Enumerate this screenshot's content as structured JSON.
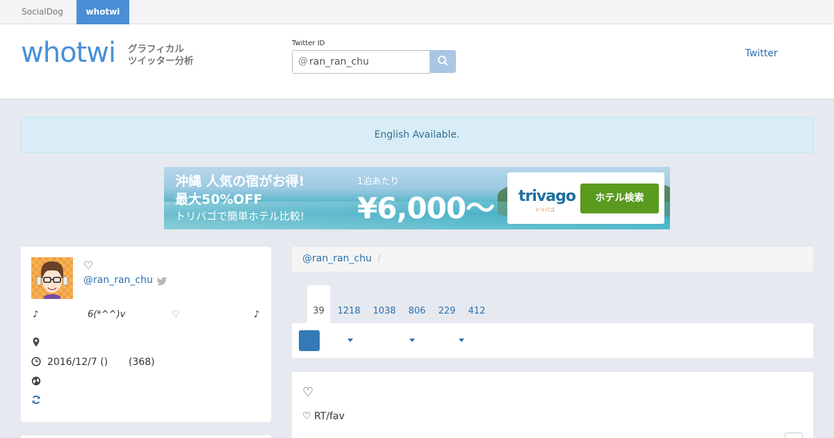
{
  "topbar": {
    "tabs": [
      {
        "label": "SocialDog",
        "active": false
      },
      {
        "label": "whotwi",
        "active": true
      }
    ]
  },
  "header": {
    "logo": "whotwi",
    "tagline_1": "グラフィカル",
    "tagline_2": "ツイッター分析",
    "search_label": "Twitter ID",
    "search_prefix": "@",
    "search_value": "ran_ran_chu",
    "twitter_link": "Twitter"
  },
  "alert": {
    "text": "English Available."
  },
  "banner": {
    "line1": "沖縄 人気の宿がお得!",
    "line2": "最大50%OFF",
    "line3": "トリバゴで簡単ホテル比較!",
    "per_night": "1泊あたり",
    "price": "¥6,000〜",
    "brand": "trivago",
    "brand_sub": "トリバゴ",
    "button": "ホテル検索"
  },
  "profile": {
    "heart": "♡",
    "handle": "@ran_ran_chu",
    "bio": [
      "♪",
      "6(*^^)v",
      "♡",
      "♪"
    ],
    "date": "2016/12/7 ()",
    "days": "(368)"
  },
  "breadcrumb": {
    "handle": "@ran_ran_chu",
    "sep": "/"
  },
  "tabs": [
    "39",
    "1218",
    "1038",
    "806",
    "229",
    "412"
  ],
  "content": {
    "heart": "♡",
    "rt_fav": "♡ RT/fav"
  },
  "colors": {
    "accent": "#4a8fd6",
    "link": "#2a6fb0",
    "alert_bg": "#d9edf7"
  }
}
